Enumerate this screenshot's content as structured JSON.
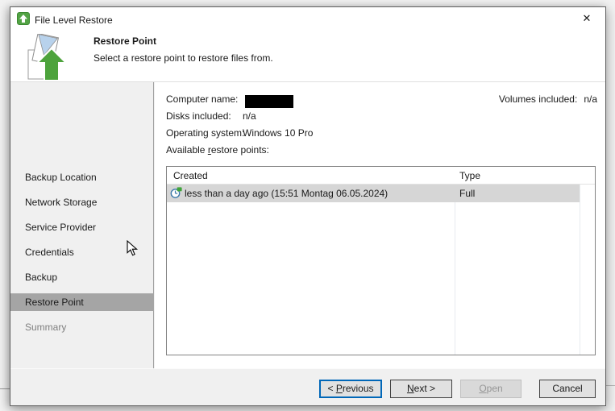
{
  "colors": {
    "veeam_green": "#4da33c",
    "sidebar_selection_gray": "#a5a5a5",
    "row_selection_gray": "#d6d6d6",
    "focus_blue": "#0067b8"
  },
  "window": {
    "title": "File Level Restore",
    "close_glyph": "✕"
  },
  "header": {
    "title": "Restore Point",
    "subtitle": "Select a restore point to restore files from."
  },
  "sidebar": {
    "items": [
      {
        "label": "Backup Location",
        "state": "enabled"
      },
      {
        "label": "Network Storage",
        "state": "enabled"
      },
      {
        "label": "Service Provider",
        "state": "enabled"
      },
      {
        "label": "Credentials",
        "state": "enabled"
      },
      {
        "label": "Backup",
        "state": "enabled"
      },
      {
        "label": "Restore Point",
        "state": "selected"
      },
      {
        "label": "Summary",
        "state": "disabled"
      }
    ]
  },
  "info": {
    "computer_name_label": "Computer name:",
    "computer_name_redacted": true,
    "disks_label": "Disks included:",
    "disks_value": "n/a",
    "os_label": "Operating system:",
    "os_value": "Windows 10 Pro",
    "volumes_label": "Volumes included:",
    "volumes_value": "n/a",
    "available_pre": "Available ",
    "available_mnemonic": "r",
    "available_post": "estore points:"
  },
  "table": {
    "columns": [
      "Created",
      "Type"
    ],
    "rows": [
      {
        "created": "less than a day ago (15:51 Montag 06.05.2024)",
        "type": "Full",
        "selected": true,
        "icon": "restore-point-clock-icon"
      }
    ]
  },
  "buttons": {
    "previous": {
      "pre": "< ",
      "mnemonic": "P",
      "post": "revious",
      "state": "focused"
    },
    "next": {
      "pre": "",
      "mnemonic": "N",
      "post": "ext >",
      "state": "enabled"
    },
    "open": {
      "pre": "",
      "mnemonic": "O",
      "post": "pen",
      "state": "disabled"
    },
    "cancel": {
      "pre": "",
      "mnemonic": "",
      "post": "Cancel",
      "state": "enabled"
    }
  }
}
